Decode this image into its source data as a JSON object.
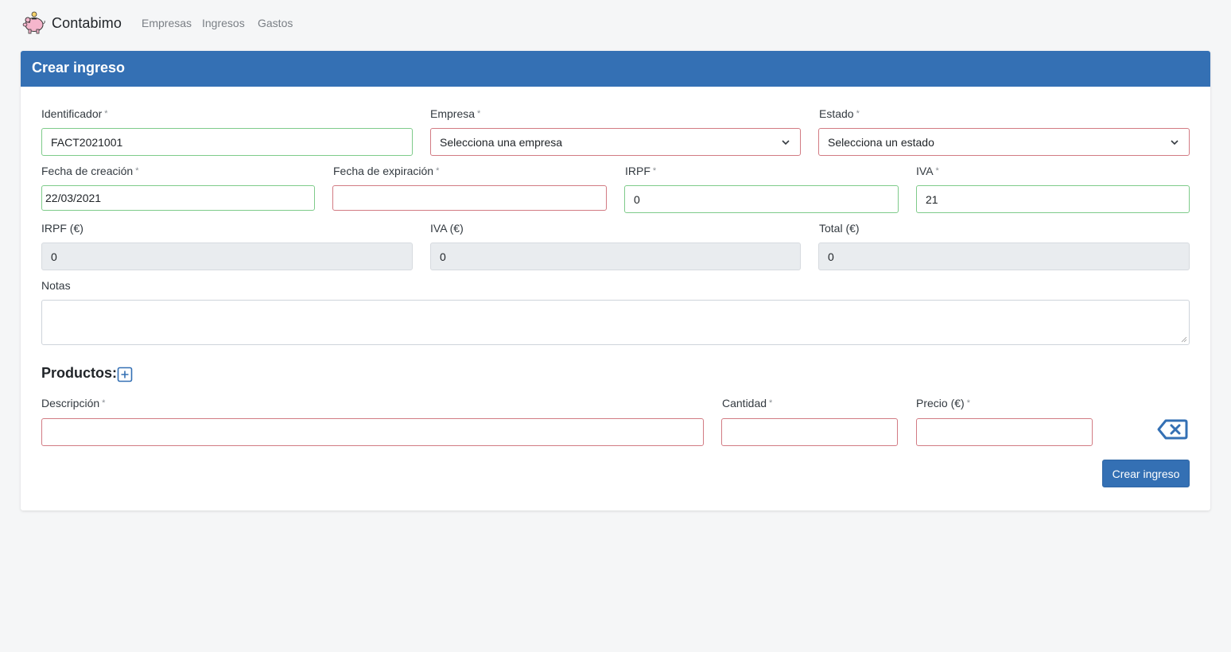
{
  "navbar": {
    "brand": "Contabimo",
    "brand_icon": "piggy-bank-icon",
    "links": [
      "Empresas",
      "Ingresos",
      "Gastos"
    ]
  },
  "form": {
    "title": "Crear ingreso",
    "required_mark": "*",
    "identificador": {
      "label": "Identificador",
      "value": "FACT2021001"
    },
    "empresa": {
      "label": "Empresa",
      "value": "Selecciona una empresa"
    },
    "estado": {
      "label": "Estado",
      "value": "Selecciona un estado"
    },
    "fecha_creacion": {
      "label": "Fecha de creación",
      "value": "22/03/2021"
    },
    "fecha_expiracion": {
      "label": "Fecha de expiración",
      "value": ""
    },
    "irpf": {
      "label": "IRPF",
      "value": "0"
    },
    "iva": {
      "label": "IVA",
      "value": "21"
    },
    "irpf_eur": {
      "label": "IRPF (€)",
      "value": "0"
    },
    "iva_eur": {
      "label": "IVA (€)",
      "value": "0"
    },
    "total_eur": {
      "label": "Total (€)",
      "value": "0"
    },
    "notas": {
      "label": "Notas",
      "value": ""
    },
    "productos": {
      "title": "Productos:",
      "add_icon": "plus-square-icon",
      "descripcion_label": "Descripción",
      "cantidad_label": "Cantidad",
      "precio_label": "Precio (€)",
      "delete_icon": "backspace-icon"
    },
    "submit_label": "Crear ingreso"
  },
  "colors": {
    "primary": "#3470b4",
    "valid_border": "#7ecb8a",
    "invalid_border": "#d27b83",
    "readonly_bg": "#e9ecef"
  }
}
